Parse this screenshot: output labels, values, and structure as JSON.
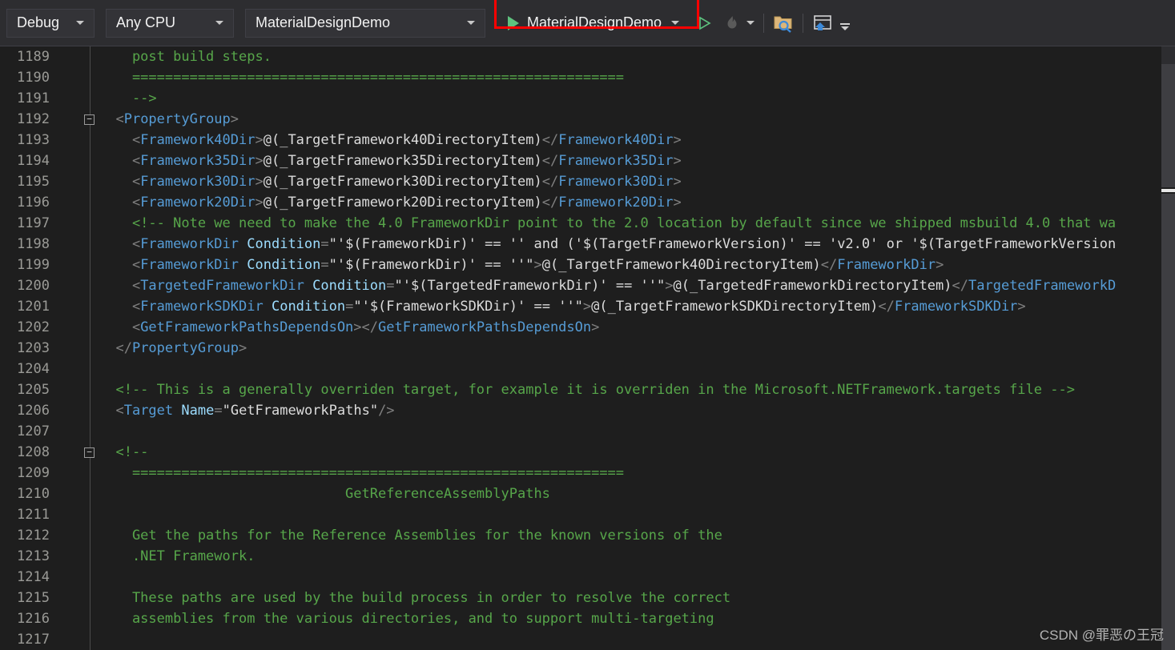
{
  "toolbar": {
    "config_combo": {
      "label": "Debug",
      "icon": "chevron-down-icon"
    },
    "platform_combo": {
      "label": "Any CPU",
      "icon": "chevron-down-icon"
    },
    "startup_project_combo": {
      "label": "MaterialDesignDemo",
      "icon": "chevron-down-icon"
    },
    "run_button": {
      "label": "MaterialDesignDemo",
      "icon": "play-icon"
    },
    "start_without_debug_icon": "play-outline-icon",
    "hot_reload_icon": "flame-icon",
    "hot_reload_caret_icon": "chevron-down-icon",
    "solution_explorer_search_icon": "folder-search-icon",
    "live_visual_tree_icon": "window-home-icon",
    "overflow_icon": "toolbar-overflow-icon",
    "highlight_color": "#ff0000"
  },
  "editor": {
    "colors": {
      "background": "#1e1e1e",
      "comment": "#57a64a",
      "tag": "#569cd6",
      "attribute": "#9cdcfe",
      "text": "#dcdcdc",
      "line_number": "#9a9a96"
    },
    "first_line_number": 1189,
    "lines": [
      {
        "n": 1189,
        "fold": false,
        "html": "<span class=\"cm\">    post build steps.</span>"
      },
      {
        "n": 1190,
        "fold": false,
        "html": "<span class=\"cm\">    ============================================================</span>"
      },
      {
        "n": 1191,
        "fold": false,
        "html": "<span class=\"cm\">    --&gt;</span>"
      },
      {
        "n": 1192,
        "fold": true,
        "html": "<span class=\"br\">  &lt;</span><span class=\"tag\">PropertyGroup</span><span class=\"br\">&gt;</span>"
      },
      {
        "n": 1193,
        "fold": false,
        "html": "<span class=\"br\">    &lt;</span><span class=\"tag\">Framework40Dir</span><span class=\"br\">&gt;</span><span class=\"tx\">@(_TargetFramework40DirectoryItem)</span><span class=\"br\">&lt;/</span><span class=\"tag\">Framework40Dir</span><span class=\"br\">&gt;</span>"
      },
      {
        "n": 1194,
        "fold": false,
        "html": "<span class=\"br\">    &lt;</span><span class=\"tag\">Framework35Dir</span><span class=\"br\">&gt;</span><span class=\"tx\">@(_TargetFramework35DirectoryItem)</span><span class=\"br\">&lt;/</span><span class=\"tag\">Framework35Dir</span><span class=\"br\">&gt;</span>"
      },
      {
        "n": 1195,
        "fold": false,
        "html": "<span class=\"br\">    &lt;</span><span class=\"tag\">Framework30Dir</span><span class=\"br\">&gt;</span><span class=\"tx\">@(_TargetFramework30DirectoryItem)</span><span class=\"br\">&lt;/</span><span class=\"tag\">Framework30Dir</span><span class=\"br\">&gt;</span>"
      },
      {
        "n": 1196,
        "fold": false,
        "html": "<span class=\"br\">    &lt;</span><span class=\"tag\">Framework20Dir</span><span class=\"br\">&gt;</span><span class=\"tx\">@(_TargetFramework20DirectoryItem)</span><span class=\"br\">&lt;/</span><span class=\"tag\">Framework20Dir</span><span class=\"br\">&gt;</span>"
      },
      {
        "n": 1197,
        "fold": false,
        "html": "<span class=\"cm\">    &lt;!-- Note we need to make the 4.0 FrameworkDir point to the 2.0 location by default since we shipped msbuild 4.0 that wa</span>"
      },
      {
        "n": 1198,
        "fold": false,
        "html": "<span class=\"br\">    &lt;</span><span class=\"tag\">FrameworkDir</span> <span class=\"at\">Condition</span><span class=\"br\">=</span><span class=\"tx\">\"'$(FrameworkDir)' == '' and ('$(TargetFrameworkVersion)' == 'v2.0' or '$(TargetFrameworkVersion</span>"
      },
      {
        "n": 1199,
        "fold": false,
        "html": "<span class=\"br\">    &lt;</span><span class=\"tag\">FrameworkDir</span> <span class=\"at\">Condition</span><span class=\"br\">=</span><span class=\"tx\">\"'$(FrameworkDir)' == ''\"</span><span class=\"br\">&gt;</span><span class=\"tx\">@(_TargetFramework40DirectoryItem)</span><span class=\"br\">&lt;/</span><span class=\"tag\">FrameworkDir</span><span class=\"br\">&gt;</span>"
      },
      {
        "n": 1200,
        "fold": false,
        "html": "<span class=\"br\">    &lt;</span><span class=\"tag\">TargetedFrameworkDir</span> <span class=\"at\">Condition</span><span class=\"br\">=</span><span class=\"tx\">\"'$(TargetedFrameworkDir)' == ''\"</span><span class=\"br\">&gt;</span><span class=\"tx\">@(_TargetedFrameworkDirectoryItem)</span><span class=\"br\">&lt;/</span><span class=\"tag\">TargetedFrameworkD</span>"
      },
      {
        "n": 1201,
        "fold": false,
        "html": "<span class=\"br\">    &lt;</span><span class=\"tag\">FrameworkSDKDir</span> <span class=\"at\">Condition</span><span class=\"br\">=</span><span class=\"tx\">\"'$(FrameworkSDKDir)' == ''\"</span><span class=\"br\">&gt;</span><span class=\"tx\">@(_TargetFrameworkSDKDirectoryItem)</span><span class=\"br\">&lt;/</span><span class=\"tag\">FrameworkSDKDir</span><span class=\"br\">&gt;</span>"
      },
      {
        "n": 1202,
        "fold": false,
        "html": "<span class=\"br\">    &lt;</span><span class=\"tag\">GetFrameworkPathsDependsOn</span><span class=\"br\">&gt;&lt;/</span><span class=\"tag\">GetFrameworkPathsDependsOn</span><span class=\"br\">&gt;</span>"
      },
      {
        "n": 1203,
        "fold": false,
        "html": "<span class=\"br\">  &lt;/</span><span class=\"tag\">PropertyGroup</span><span class=\"br\">&gt;</span>"
      },
      {
        "n": 1204,
        "fold": false,
        "html": ""
      },
      {
        "n": 1205,
        "fold": false,
        "html": "<span class=\"cm\">  &lt;!-- This is a generally overriden target, for example it is overriden in the Microsoft.NETFramework.targets file --&gt;</span>"
      },
      {
        "n": 1206,
        "fold": false,
        "html": "<span class=\"br\">  &lt;</span><span class=\"tag\">Target</span> <span class=\"at\">Name</span><span class=\"br\">=</span><span class=\"tx\">\"GetFrameworkPaths\"</span><span class=\"br\">/&gt;</span>"
      },
      {
        "n": 1207,
        "fold": false,
        "html": ""
      },
      {
        "n": 1208,
        "fold": true,
        "html": "<span class=\"cm\">  &lt;!--</span>"
      },
      {
        "n": 1209,
        "fold": false,
        "html": "<span class=\"cm\">    ============================================================</span>"
      },
      {
        "n": 1210,
        "fold": false,
        "html": "<span class=\"cm\">                              GetReferenceAssemblyPaths</span>"
      },
      {
        "n": 1211,
        "fold": false,
        "html": ""
      },
      {
        "n": 1212,
        "fold": false,
        "html": "<span class=\"cm\">    Get the paths for the Reference Assemblies for the known versions of the</span>"
      },
      {
        "n": 1213,
        "fold": false,
        "html": "<span class=\"cm\">    .NET Framework.</span>"
      },
      {
        "n": 1214,
        "fold": false,
        "html": ""
      },
      {
        "n": 1215,
        "fold": false,
        "html": "<span class=\"cm\">    These paths are used by the build process in order to resolve the correct</span>"
      },
      {
        "n": 1216,
        "fold": false,
        "html": "<span class=\"cm\">    assemblies from the various directories, and to support multi-targeting</span>"
      },
      {
        "n": 1217,
        "fold": false,
        "html": "<span class=\"cm\">    </span>"
      }
    ]
  },
  "scrollbar": {
    "name": "vertical-scrollbar"
  },
  "watermark": {
    "text": "CSDN @罪恶の王冠"
  }
}
